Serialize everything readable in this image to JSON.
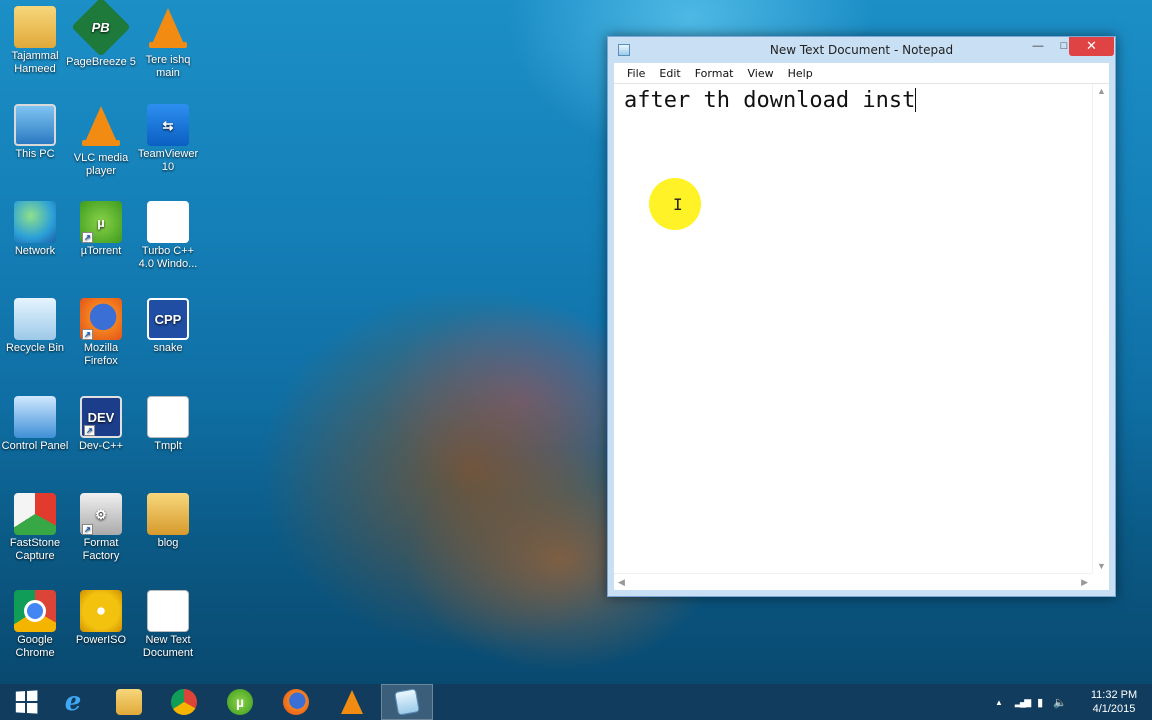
{
  "desktop": {
    "icons": [
      {
        "label": "Tajammal Hameed",
        "glyph": "folder-user-icon"
      },
      {
        "label": "PageBreeze 5",
        "glyph": "pagebreeze-icon"
      },
      {
        "label": "Tere ishq main",
        "glyph": "vlc-cone-icon"
      },
      {
        "label": "This PC",
        "glyph": "computer-icon"
      },
      {
        "label": "VLC media player",
        "glyph": "vlc-cone-icon"
      },
      {
        "label": "TeamViewer 10",
        "glyph": "teamviewer-icon"
      },
      {
        "label": "Network",
        "glyph": "network-globe-icon"
      },
      {
        "label": "µTorrent",
        "glyph": "utorrent-icon"
      },
      {
        "label": "Turbo C++ 4.0 Windo...",
        "glyph": "apple-icon"
      },
      {
        "label": "Recycle Bin",
        "glyph": "recycle-bin-icon"
      },
      {
        "label": "Mozilla Firefox",
        "glyph": "firefox-icon"
      },
      {
        "label": "snake",
        "glyph": "cpp-file-icon"
      },
      {
        "label": "Control Panel",
        "glyph": "control-panel-icon"
      },
      {
        "label": "Dev-C++",
        "glyph": "devcpp-icon"
      },
      {
        "label": "Tmplt",
        "glyph": "text-file-icon"
      },
      {
        "label": "FastStone Capture",
        "glyph": "faststone-icon"
      },
      {
        "label": "Format Factory",
        "glyph": "format-factory-icon"
      },
      {
        "label": "blog",
        "glyph": "folder-icon"
      },
      {
        "label": "Google Chrome",
        "glyph": "chrome-icon"
      },
      {
        "label": "PowerISO",
        "glyph": "poweriso-icon"
      },
      {
        "label": "New Text Document",
        "glyph": "text-file-icon"
      }
    ],
    "pb_glyph": "PB",
    "dev_glyph": "DEV",
    "cpp_glyph": "CPP"
  },
  "notepad": {
    "title": "New Text Document - Notepad",
    "minimize": "—",
    "maximize": "□",
    "close": "✕",
    "menu": [
      "File",
      "Edit",
      "Format",
      "View",
      "Help"
    ],
    "content": "after th download inst"
  },
  "taskbar": {
    "items": [
      "start-windows-icon",
      "internet-explorer-icon",
      "file-explorer-icon",
      "chrome-icon",
      "utorrent-icon",
      "firefox-icon",
      "vlc-cone-icon",
      "notepad-icon"
    ],
    "ie_glyph": "e",
    "ut_glyph": "µ",
    "tray": {
      "chevron": "▲",
      "signal": "▂▄▆",
      "battery": "▮",
      "volume": "🔈"
    },
    "time": "11:32 PM",
    "date": "4/1/2015"
  }
}
